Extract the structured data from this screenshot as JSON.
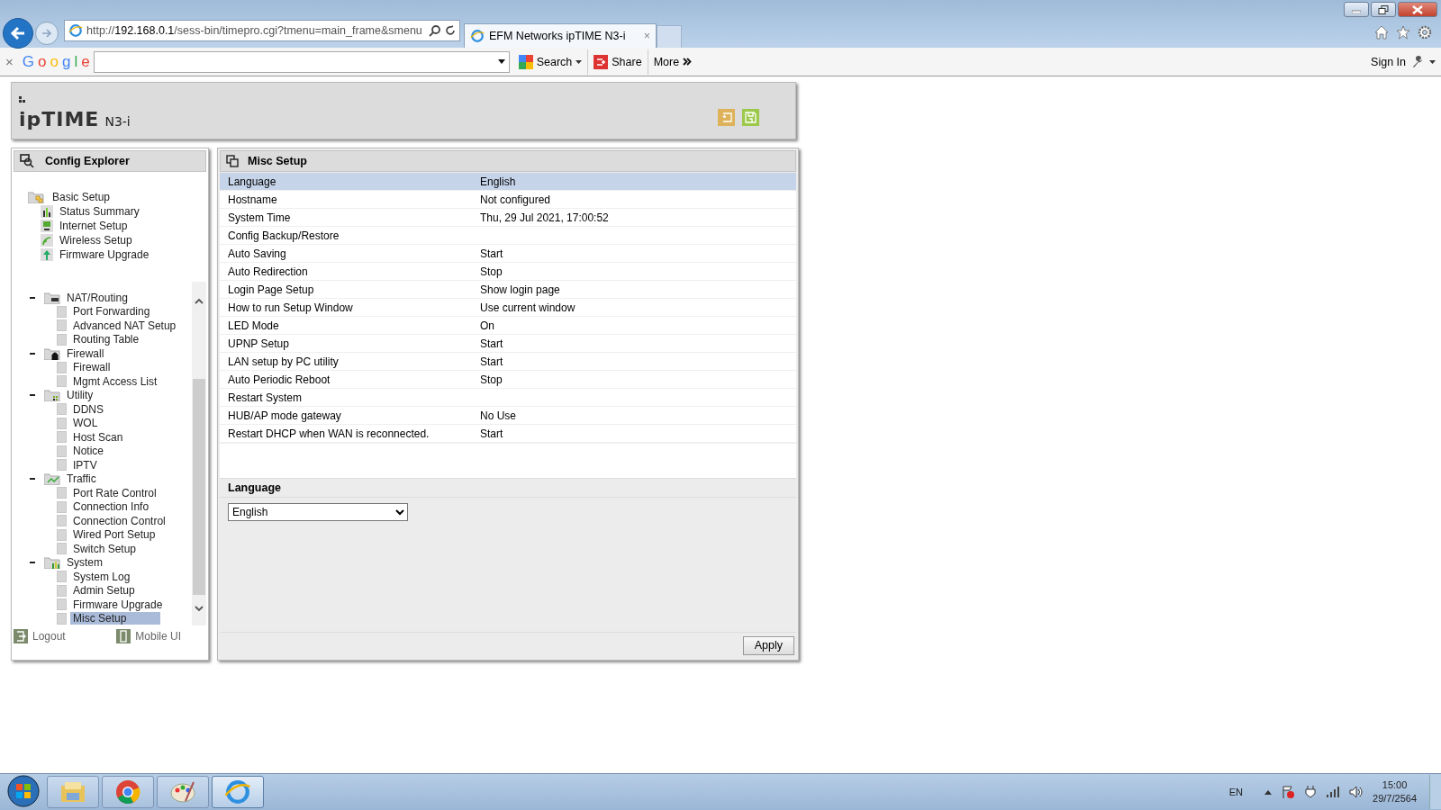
{
  "browser": {
    "address": {
      "scheme": "http://",
      "host": "192.168.0.1",
      "path": "/sess-bin/timepro.cgi?tmenu=main_frame&smenu"
    },
    "tab": {
      "title": "EFM Networks ipTIME N3-i",
      "close": "×",
      "selected": true
    },
    "toolbar": {
      "close": "×",
      "logo": "Google",
      "search": "Search",
      "share": "Share",
      "more": "More",
      "sign_in": "Sign In"
    }
  },
  "header": {
    "brand": "ipTIME",
    "model": "N3-i"
  },
  "sidebar": {
    "title": "Config Explorer",
    "basic": {
      "label": "Basic Setup",
      "items": [
        {
          "label": "Status Summary"
        },
        {
          "label": "Internet Setup"
        },
        {
          "label": "Wireless Setup"
        },
        {
          "label": "Firmware Upgrade"
        }
      ]
    },
    "groups": [
      {
        "label": "NAT/Routing",
        "expanded": true,
        "items": [
          {
            "label": "Port Forwarding",
            "selected": false
          },
          {
            "label": "Advanced NAT Setup",
            "selected": false
          },
          {
            "label": "Routing Table",
            "selected": false
          }
        ]
      },
      {
        "label": "Firewall",
        "expanded": true,
        "items": [
          {
            "label": "Firewall",
            "selected": false
          },
          {
            "label": "Mgmt Access List",
            "selected": false
          }
        ]
      },
      {
        "label": "Utility",
        "expanded": true,
        "items": [
          {
            "label": "DDNS",
            "selected": false
          },
          {
            "label": "WOL",
            "selected": false
          },
          {
            "label": "Host Scan",
            "selected": false
          },
          {
            "label": "Notice",
            "selected": false
          },
          {
            "label": "IPTV",
            "selected": false
          }
        ]
      },
      {
        "label": "Traffic",
        "expanded": true,
        "items": [
          {
            "label": "Port Rate Control",
            "selected": false
          },
          {
            "label": "Connection Info",
            "selected": false
          },
          {
            "label": "Connection Control",
            "selected": false
          },
          {
            "label": "Wired Port Setup",
            "selected": false
          },
          {
            "label": "Switch Setup",
            "selected": false
          }
        ]
      },
      {
        "label": "System",
        "expanded": true,
        "items": [
          {
            "label": "System Log",
            "selected": false
          },
          {
            "label": "Admin Setup",
            "selected": false
          },
          {
            "label": "Firmware Upgrade",
            "selected": false
          },
          {
            "label": "Misc Setup",
            "selected": true
          }
        ]
      }
    ],
    "footer": {
      "logout": "Logout",
      "mobile": "Mobile UI"
    }
  },
  "main": {
    "title": "Misc Setup",
    "rows": [
      {
        "label": "Language",
        "value": "English",
        "selected": true
      },
      {
        "label": "Hostname",
        "value": "Not configured",
        "selected": false
      },
      {
        "label": "System Time",
        "value": "Thu, 29 Jul 2021, 17:00:52",
        "selected": false
      },
      {
        "label": "Config Backup/Restore",
        "selected": false
      },
      {
        "label": "Auto Saving",
        "value": "Start",
        "selected": false
      },
      {
        "label": "Auto Redirection",
        "value": "Stop",
        "selected": false
      },
      {
        "label": "Login Page Setup",
        "value": "Show login page",
        "selected": false
      },
      {
        "label": "How to run Setup Window",
        "value": "Use current window",
        "selected": false
      },
      {
        "label": "LED Mode",
        "value": "On",
        "selected": false
      },
      {
        "label": "UPNP Setup",
        "value": "Start",
        "selected": false
      },
      {
        "label": "LAN setup by PC utility",
        "value": "Start",
        "selected": false
      },
      {
        "label": "Auto Periodic Reboot",
        "value": "Stop",
        "selected": false
      },
      {
        "label": "Restart System",
        "selected": false
      },
      {
        "label": "HUB/AP mode gateway",
        "value": "No Use",
        "selected": false
      },
      {
        "label": "Restart DHCP when WAN is reconnected.",
        "value": "Start",
        "selected": false
      }
    ],
    "section": {
      "title": "Language",
      "select_value": "English"
    },
    "apply": "Apply"
  },
  "taskbar": {
    "apps": [
      {
        "kind": "explorer",
        "selected": false
      },
      {
        "kind": "chrome",
        "selected": false
      },
      {
        "kind": "paint",
        "selected": false
      },
      {
        "kind": "ie",
        "selected": true
      }
    ],
    "language": "EN",
    "time": "15:00",
    "date": "29/7/2564"
  }
}
